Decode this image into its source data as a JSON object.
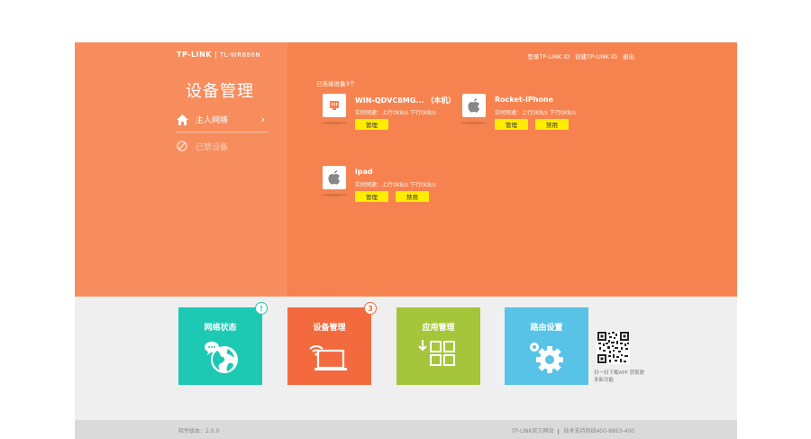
{
  "header": {
    "brand": "TP-LINK",
    "model": "TL-WR886N",
    "links": [
      "登录TP-LINK ID",
      "创建TP-LINK ID",
      "退出"
    ]
  },
  "sidebar": {
    "title": "设备管理",
    "items": [
      {
        "label": "主人网络",
        "icon": "home-icon"
      },
      {
        "label": "已禁设备",
        "icon": "block-icon"
      }
    ]
  },
  "main": {
    "connected_label": "已连接设备3个",
    "devices": [
      {
        "name": "WIN-QDVC8MG... （本机）",
        "speed": "实时网速：上行0KB/s 下行0KB/s",
        "icon": "ethernet-icon",
        "buttons": [
          "管理"
        ]
      },
      {
        "name": "Rocket-iPhone",
        "speed": "实时网速：上行0KB/s 下行0KB/s",
        "icon": "apple-icon",
        "buttons": [
          "管理",
          "禁用"
        ]
      },
      {
        "name": "ipad",
        "speed": "实时网速：上行0KB/s 下行0KB/s",
        "icon": "apple-icon",
        "buttons": [
          "管理",
          "禁用"
        ]
      }
    ]
  },
  "tiles": [
    {
      "label": "网络状态",
      "badge": "!",
      "color": "#1ec9b3"
    },
    {
      "label": "设备管理",
      "badge": "3",
      "color": "#f46a3f"
    },
    {
      "label": "应用管理",
      "badge": "",
      "color": "#a5c63a"
    },
    {
      "label": "路由设置",
      "badge": "",
      "color": "#58c3e6"
    }
  ],
  "qr_caption": "扫一扫下载APP 获取更多新功能",
  "footer": {
    "version": "软件版本：2.0.0",
    "site": "TP-LINK官方网站",
    "hotline": "技术支持热线400-8863-400"
  },
  "colors": {
    "accent": "#f6834f",
    "button": "#ffec00"
  }
}
